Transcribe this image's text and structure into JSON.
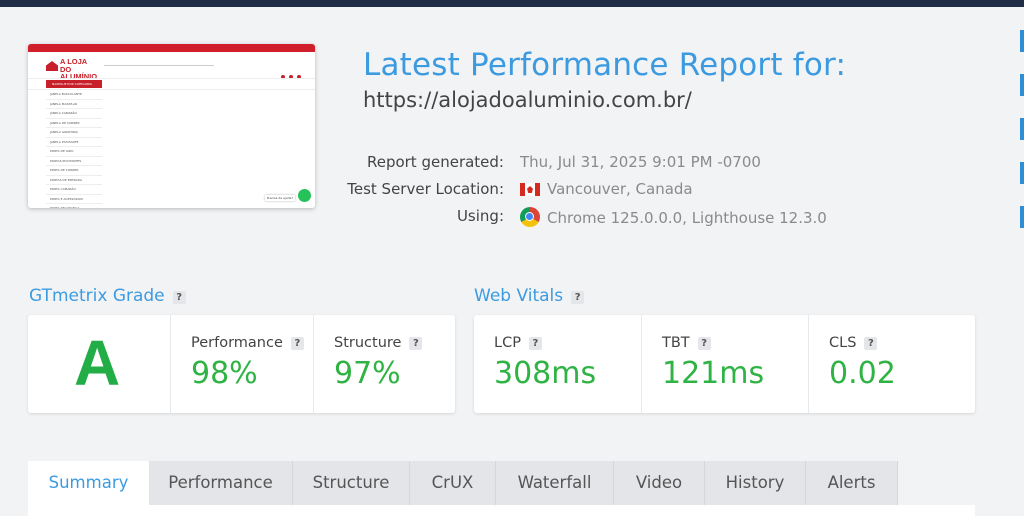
{
  "thumbnail": {
    "logo_line1": "A LOJA DO",
    "logo_line2": "ALUMÍNIO",
    "nav_category": "NAVEGUE POR CATEGORIA",
    "side_items": [
      "JANELA BASCULANTE",
      "JANELA MAXIM-AR",
      "JANELA CAMARÃO",
      "JANELA DE CORRER",
      "JANELA GIRATÓRIA",
      "JANELA PIVOTANTE",
      "PORTA DE GIRO",
      "PORTAS PIVOTANTES",
      "PORTA DE CORRER",
      "PORTAS DE ENTRADA",
      "PORTA CAMARÃO",
      "PORTA E ACESSÓRIOS",
      "PORTA SEGURANÇA"
    ],
    "chat_label": "Precisa de ajuda?"
  },
  "report": {
    "title": "Latest Performance Report for:",
    "url": "https://alojadoaluminio.com.br/",
    "generated_label": "Report generated:",
    "generated_value": "Thu, Jul 31, 2025 9:01 PM -0700",
    "location_label": "Test Server Location:",
    "location_value": "Vancouver, Canada",
    "using_label": "Using:",
    "using_value": "Chrome 125.0.0.0, Lighthouse 12.3.0"
  },
  "grade": {
    "title": "GTmetrix Grade",
    "help": "?",
    "letter": "A",
    "performance_label": "Performance",
    "performance_value": "98%",
    "structure_label": "Structure",
    "structure_value": "97%"
  },
  "vitals": {
    "title": "Web Vitals",
    "help": "?",
    "lcp_label": "LCP",
    "lcp_value": "308ms",
    "tbt_label": "TBT",
    "tbt_value": "121ms",
    "cls_label": "CLS",
    "cls_value": "0.02"
  },
  "tabs": [
    "Summary",
    "Performance",
    "Structure",
    "CrUX",
    "Waterfall",
    "Video",
    "History",
    "Alerts"
  ],
  "colors": {
    "accent": "#3c9be0",
    "good": "#2fb344",
    "grade": "#23ad46"
  }
}
